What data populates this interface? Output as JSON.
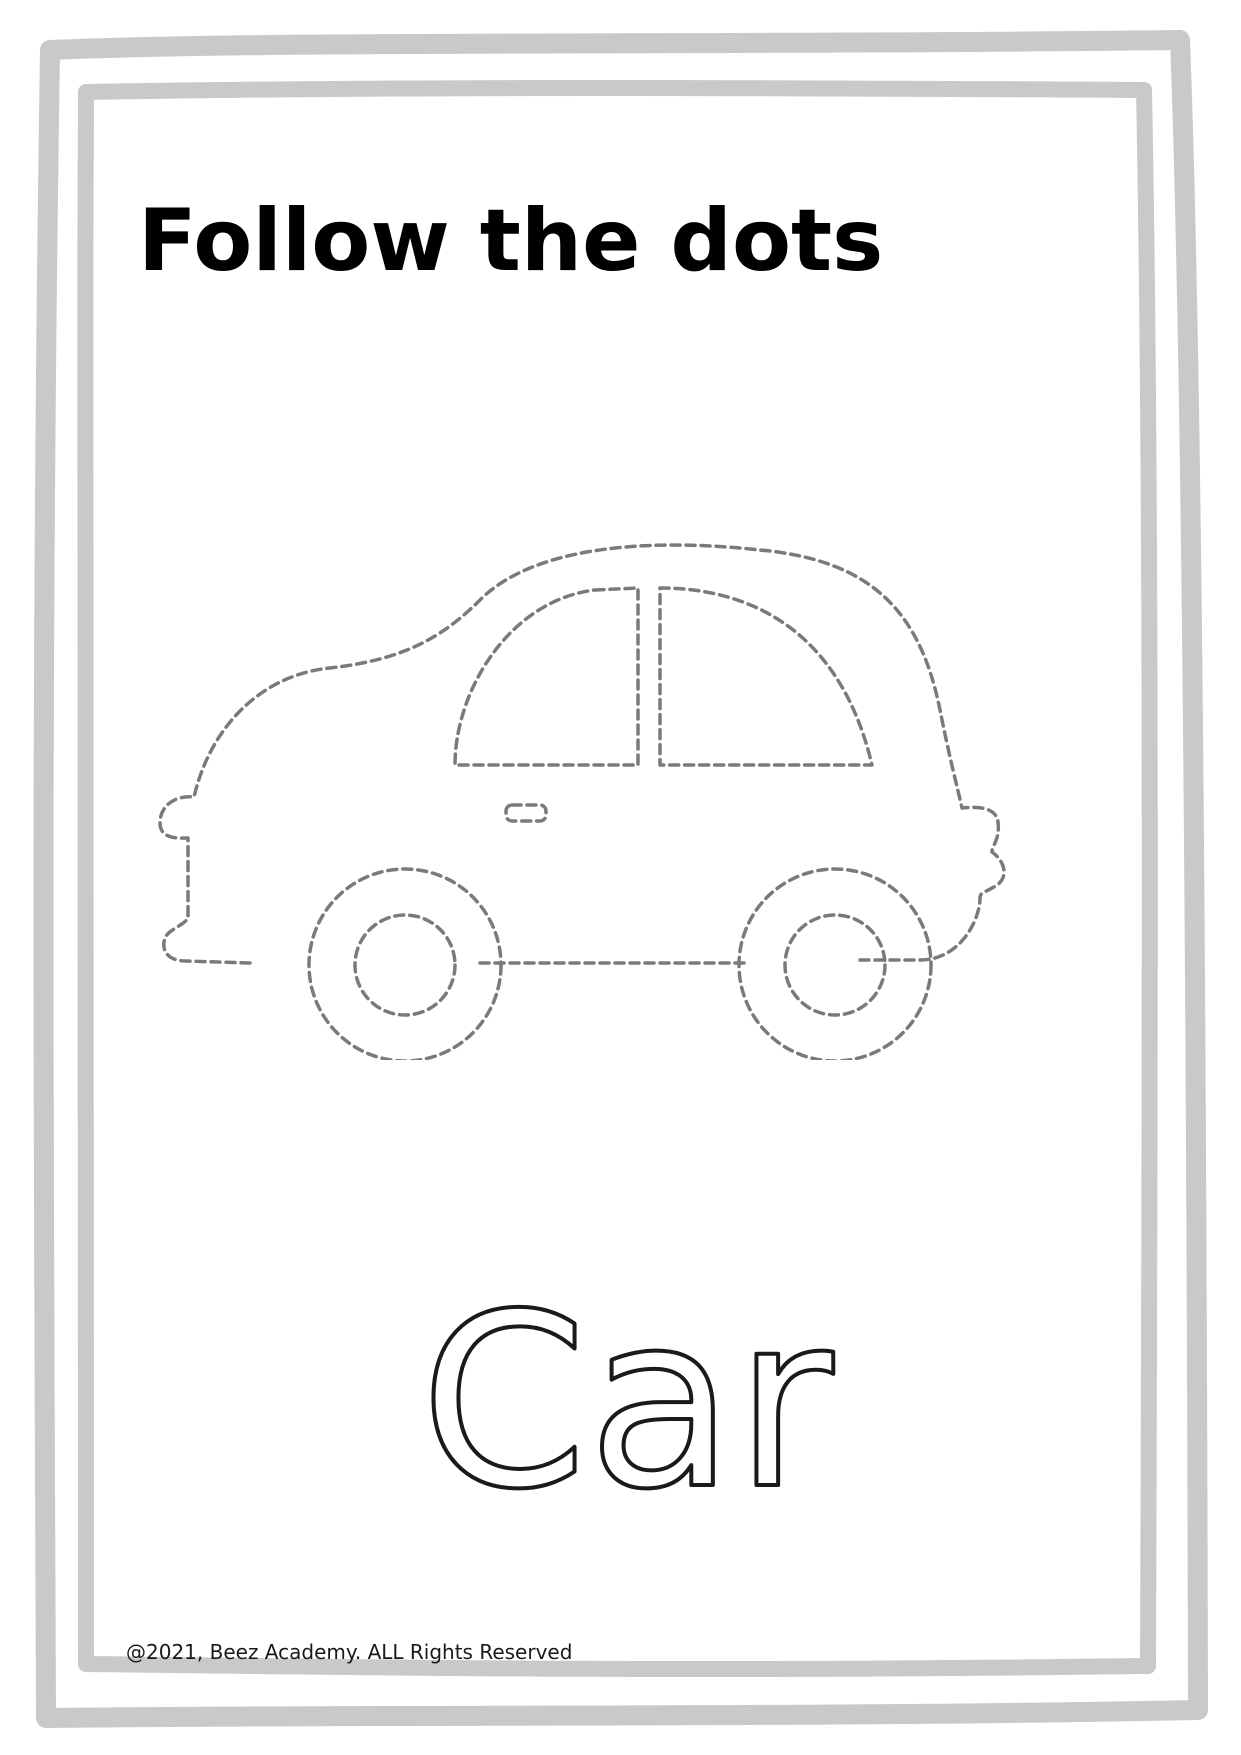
{
  "page": {
    "title": "Follow the dots",
    "word": "Car",
    "copyright": "@2021, Beez Academy. ALL Rights Reserved"
  },
  "colors": {
    "frame": "#c8c9cb",
    "dots": "#7a7a7a",
    "text": "#000000",
    "word_outline": "#1a1a1a"
  },
  "icons": {
    "illustration": "car-icon"
  }
}
